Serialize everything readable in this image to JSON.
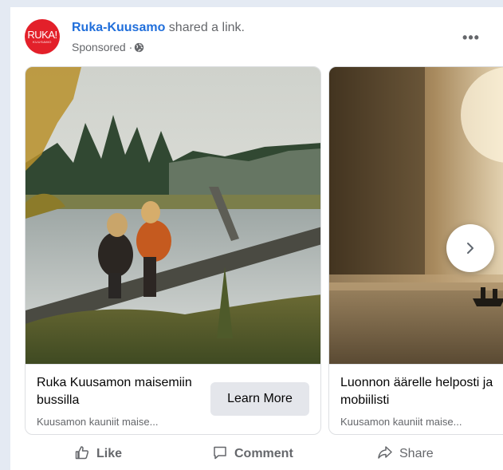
{
  "post": {
    "page_name": "Ruka-Kuusamo",
    "shared_text": " shared a link.",
    "sponsored_label": "Sponsored · ",
    "avatar": {
      "line1": "RUKA!",
      "line2": "KUUSAMO",
      "color": "#e3202a"
    },
    "more_label": "•••"
  },
  "carousel": {
    "cards": [
      {
        "title": "Ruka Kuusamon maisemiin bussilla",
        "description": "Kuusamon kauniit maise...",
        "cta": "Learn More"
      },
      {
        "title": "Luonnon äärelle helposti ja mobiilisti",
        "description": "Kuusamon kauniit maise..."
      }
    ],
    "next_icon": "chevron-right-icon"
  },
  "actions": {
    "like": "Like",
    "comment": "Comment",
    "share": "Share"
  },
  "colors": {
    "page_background": "#e4eaf3",
    "link_blue": "#216fdb",
    "secondary_text": "#65676b",
    "button_gray": "#e4e6eb"
  }
}
